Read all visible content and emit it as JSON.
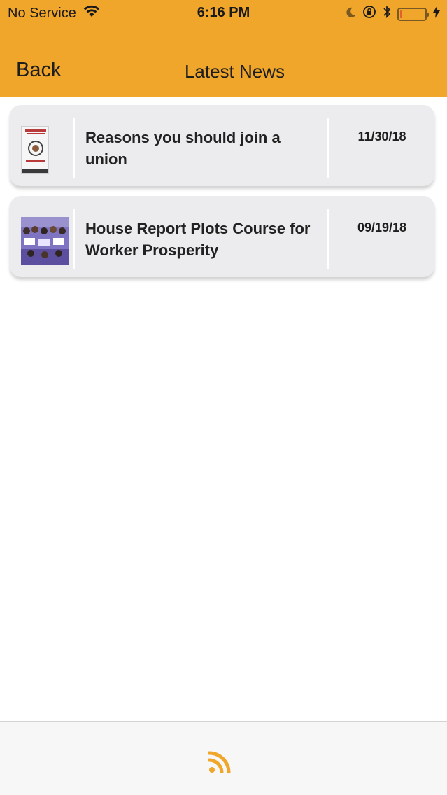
{
  "status_bar": {
    "carrier": "No Service",
    "time": "6:16 PM"
  },
  "nav": {
    "back_label": "Back",
    "title": "Latest News"
  },
  "news": [
    {
      "title": "Reasons you should join a union",
      "date": "11/30/18"
    },
    {
      "title": "House Report Plots Course for Worker Prosperity",
      "date": "09/19/18"
    }
  ],
  "tab_bar": {
    "icon": "rss-icon"
  },
  "colors": {
    "header": "#F0A62A",
    "card": "#ECECEE",
    "accent": "#F0A62A"
  }
}
